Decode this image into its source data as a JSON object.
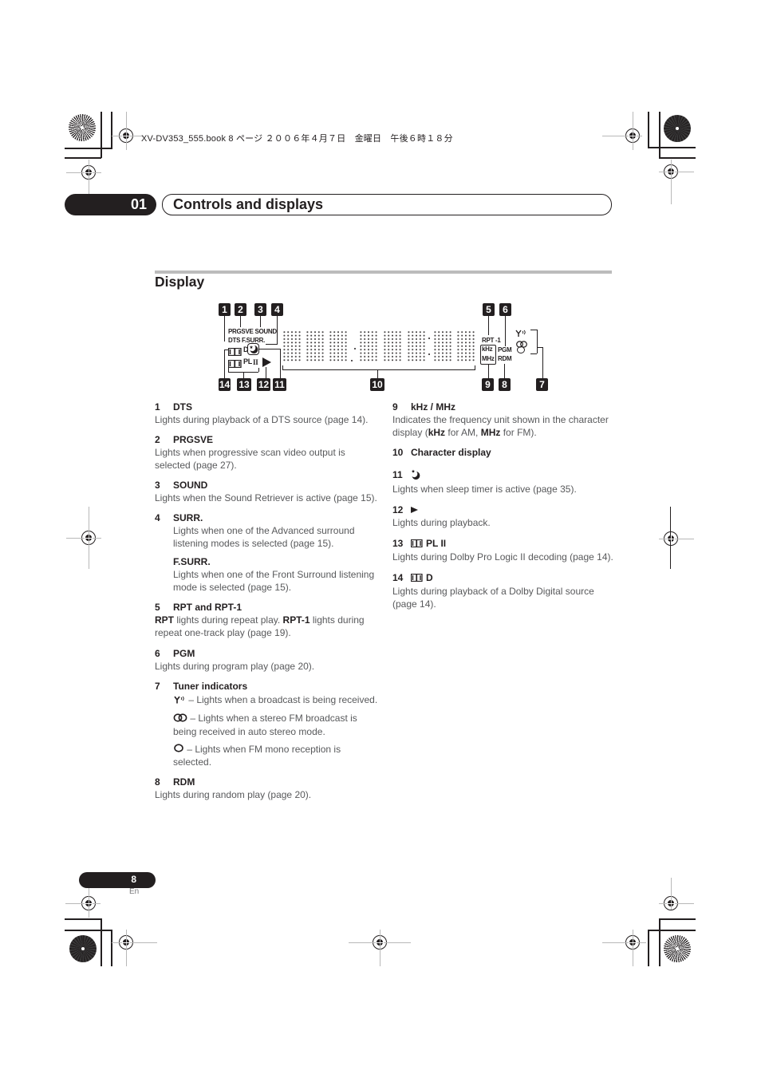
{
  "print_header": "XV-DV353_555.book  8 ページ  ２００６年４月７日　金曜日　午後６時１８分",
  "chapter": {
    "number": "01",
    "title": "Controls and displays"
  },
  "section": {
    "title": "Display"
  },
  "diagram": {
    "badges": [
      "1",
      "2",
      "3",
      "4",
      "5",
      "6",
      "7",
      "8",
      "9",
      "10",
      "11",
      "12",
      "13",
      "14"
    ],
    "labels": {
      "prgsve_sound": "PRGSVE SOUND",
      "dts_fsurr": "DTS  F.SURR.",
      "dd_d": "D",
      "dd_pl": "PL",
      "pl_ii": "II",
      "rpt": "RPT  -1",
      "khz": "kHz",
      "mhz": "MHz",
      "pgm": "PGM",
      "rdm": "RDM"
    }
  },
  "entries_left": [
    {
      "num": "1",
      "title": "DTS",
      "body": "Lights during playback of a DTS source (page 14)."
    },
    {
      "num": "2",
      "title": "PRGSVE",
      "body": "Lights when progressive scan video output is selected (page 27)."
    },
    {
      "num": "3",
      "title": "SOUND",
      "body": "Lights when the Sound Retriever is active (page 15)."
    },
    {
      "num": "4",
      "title": "SURR.",
      "body": "Lights when one of the Advanced surround listening modes is selected (page 15).",
      "sub_title": "F.SURR.",
      "sub_body": "Lights when one of the Front Surround listening mode is selected (page 15)."
    },
    {
      "num": "5",
      "title": "RPT and RPT-1",
      "body_b1": "RPT",
      "body_t1": " lights during repeat play. ",
      "body_b2": "RPT-1",
      "body_t2": " lights during repeat one-track play (page 19)."
    },
    {
      "num": "6",
      "title": "PGM",
      "body": "Lights during program play (page 20)."
    },
    {
      "num": "7",
      "title": "Tuner indicators",
      "items": [
        {
          "icon": "antenna-signal-icon",
          "text": " – Lights when a broadcast is being received."
        },
        {
          "icon": "stereo-icon",
          "text": " – Lights when a stereo FM broadcast is being received in auto stereo mode."
        },
        {
          "icon": "mono-icon",
          "text": " – Lights when FM mono reception is selected."
        }
      ]
    },
    {
      "num": "8",
      "title": "RDM",
      "body": "Lights during random play (page 20)."
    }
  ],
  "entries_right": [
    {
      "num": "9",
      "title": "kHz / MHz",
      "body_t1": "Indicates the frequency unit shown in the character display (",
      "body_b1": "kHz",
      "body_t2": " for AM, ",
      "body_b2": "MHz",
      "body_t3": " for FM)."
    },
    {
      "num": "10",
      "title": "Character display"
    },
    {
      "num": "11",
      "title_icon": "sleep-timer-icon",
      "body": "Lights when sleep timer is active (page 35)."
    },
    {
      "num": "12",
      "title_icon": "play-icon",
      "body": "Lights during playback."
    },
    {
      "num": "13",
      "title": "PL II",
      "title_icon": "dolby-icon",
      "body": "Lights during Dolby Pro Logic II decoding (page 14)."
    },
    {
      "num": "14",
      "title": "D",
      "title_icon": "dolby-icon",
      "body": "Lights during playback of a Dolby Digital source (page 14)."
    }
  ],
  "footer": {
    "page_number": "8",
    "language": "En"
  },
  "colors": {
    "ink": "#231f20",
    "body_text": "#58595b",
    "rule_gray": "#bcbcbc"
  }
}
